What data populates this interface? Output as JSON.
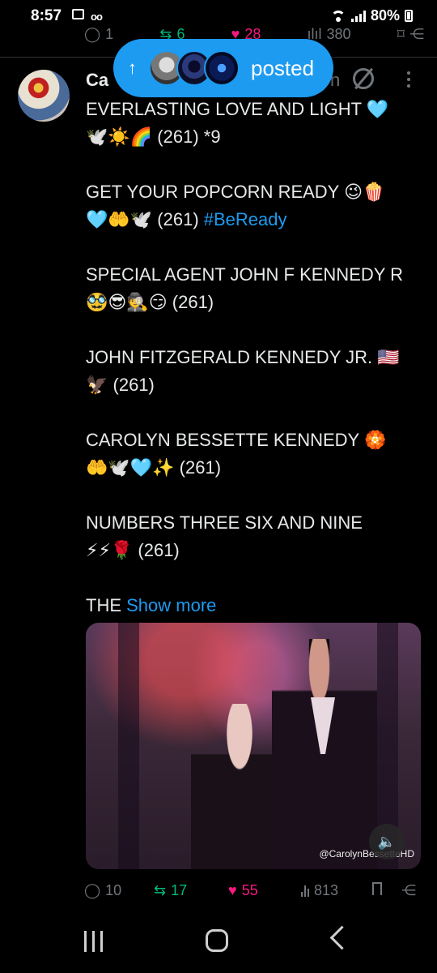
{
  "status_bar": {
    "time": "8:57",
    "battery": "80%"
  },
  "previous_tweet": {
    "replies": "1",
    "retweets": "6",
    "likes": "28",
    "views": "380"
  },
  "new_posts_pill": {
    "label": "posted"
  },
  "tweet": {
    "name_visible": "Ca",
    "time_tail": "n",
    "paragraphs": [
      "EVERLASTING LOVE AND LIGHT 🩵\n🕊️☀️🌈 (261) *9",
      "GET YOUR POPCORN READY 😉🍿\n🩵🤲🕊️ (261) ",
      "SPECIAL AGENT JOHN F KENNEDY R\n🥸😎🕵️😏 (261)",
      "JOHN FITZGERALD KENNEDY JR. 🇺🇸\n🦅 (261)",
      "CAROLYN BESSETTE KENNEDY 🏵️\n🤲🕊️🩵✨ (261)",
      "NUMBERS THREE SIX AND NINE\n⚡⚡🌹 (261)"
    ],
    "hashtag": "#BeReady",
    "last_line_start": "THE ",
    "show_more": "Show more",
    "video_watermark": "@CarolynBessetteHD",
    "replies": "10",
    "retweets": "17",
    "likes": "55",
    "views": "813"
  },
  "colors": {
    "accent": "#1d9bf0",
    "retweet": "#00ba7c",
    "like": "#f91880",
    "muted": "#71767b"
  }
}
